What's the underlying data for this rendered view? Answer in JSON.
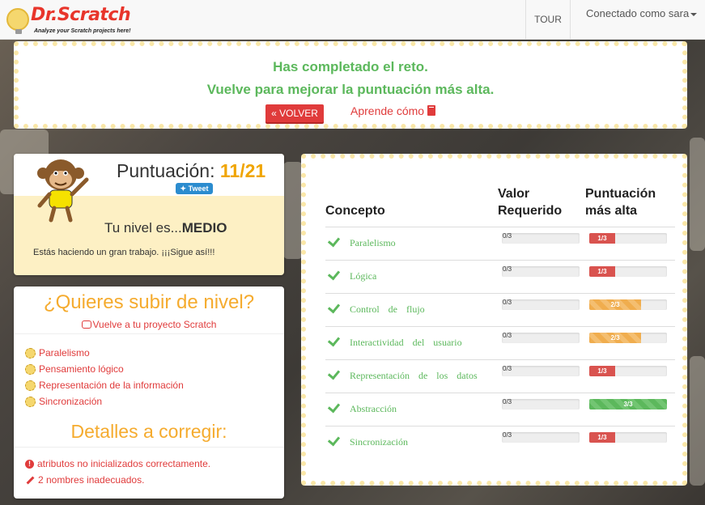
{
  "navbar": {
    "logo_title": "Dr.Scratch",
    "logo_subtitle": "Analyze your Scratch projects here!",
    "tour_label": "TOUR",
    "user_label": "Conectado como sara"
  },
  "banner": {
    "line1": "Has completado el reto.",
    "line2": "Vuelve para mejorar la puntuación más alta.",
    "back_button": "« VOLVER",
    "learn_link": "Aprende cómo"
  },
  "score": {
    "title": "Puntuación:",
    "value": "11/21",
    "tweet_label": "Tweet",
    "level_prefix": "Tu nivel es...",
    "level_value": "MEDIO",
    "praise": "Estás haciendo un gran trabajo. ¡¡¡Sigue así!!!"
  },
  "level_up": {
    "title": "¿Quieres subir de nivel?",
    "link": "Vuelve a tu proyecto Scratch",
    "items": [
      {
        "label": "Paralelismo"
      },
      {
        "label": "Pensamiento lógico"
      },
      {
        "label": "Representación de la información"
      },
      {
        "label": "Sincronización"
      }
    ],
    "fix_title": "Detalles a corregir:",
    "fixes": [
      {
        "icon": "exclamation-icon",
        "label": "atributos no inicializados correctamente."
      },
      {
        "icon": "pencil-icon",
        "label": "2 nombres inadecuados."
      }
    ]
  },
  "concepts": {
    "headers": {
      "concept": "Concepto",
      "required_1": "Valor",
      "required_2": "Requerido",
      "max_1": "Puntuación",
      "max_2": "más alta"
    },
    "rows": [
      {
        "name": "Paralelismo",
        "required": "0/3",
        "max": "1/3",
        "max_fraction": 0.333,
        "color": "red"
      },
      {
        "name": "Lógica",
        "required": "0/3",
        "max": "1/3",
        "max_fraction": 0.333,
        "color": "red"
      },
      {
        "name": "Control de flujo",
        "required": "0/3",
        "max": "2/3",
        "max_fraction": 0.667,
        "color": "orange"
      },
      {
        "name": "Interactividad del usuario",
        "required": "0/3",
        "max": "2/3",
        "max_fraction": 0.667,
        "color": "orange"
      },
      {
        "name": "Representación de los datos",
        "required": "0/3",
        "max": "1/3",
        "max_fraction": 0.333,
        "color": "red"
      },
      {
        "name": "Abstracción",
        "required": "0/3",
        "max": "3/3",
        "max_fraction": 1.0,
        "color": "green"
      },
      {
        "name": "Sincronización",
        "required": "0/3",
        "max": "1/3",
        "max_fraction": 0.333,
        "color": "red"
      }
    ]
  },
  "colors": {
    "accent_red": "#e03b3b",
    "accent_green": "#5cb85c",
    "accent_orange": "#f5ab2e"
  }
}
